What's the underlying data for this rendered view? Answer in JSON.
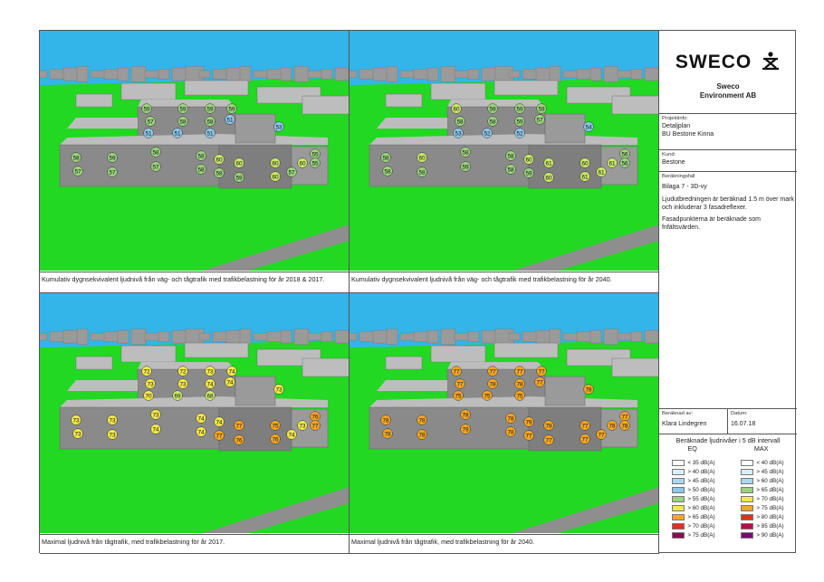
{
  "panels": [
    {
      "caption": "Kumulativ dygnsekvivalent ljudnivå från väg- och tågtrafik med trafikbelastning för år 2018 & 2017.",
      "labels": [
        "59",
        "59",
        "59",
        "59",
        "57",
        "58",
        "58",
        "51",
        "51",
        "51",
        "51",
        "53",
        "58",
        "59",
        "58",
        "58",
        "60",
        "60",
        "60",
        "60",
        "57",
        "57",
        "57",
        "58",
        "58",
        "59",
        "60",
        "57",
        "55",
        "55"
      ]
    },
    {
      "caption": "Kumulativ dygnsekvivalent ljudnivå från väg- och tågtrafik med trafikbelastning för år 2040.",
      "labels": [
        "60",
        "59",
        "59",
        "59",
        "58",
        "58",
        "59",
        "57",
        "53",
        "52",
        "52",
        "54",
        "58",
        "60",
        "58",
        "58",
        "60",
        "61",
        "60",
        "61",
        "58",
        "58",
        "59",
        "58",
        "59",
        "60",
        "61",
        "61",
        "56",
        "56"
      ]
    },
    {
      "caption": "Maximal ljudnivå från tågtrafik, med trafikbelastning för år 2017.",
      "labels": [
        "72",
        "72",
        "73",
        "74",
        "73",
        "73",
        "74",
        "74",
        "70",
        "69",
        "68",
        "73",
        "73",
        "73",
        "73",
        "74",
        "74",
        "77",
        "75",
        "73",
        "73",
        "73",
        "74",
        "74",
        "77",
        "76",
        "76",
        "74",
        "76",
        "77"
      ]
    },
    {
      "caption": "Maximal ljudnivå från tågtrafik, med trafikbelastning för år 2040.",
      "labels": [
        "77",
        "77",
        "77",
        "77",
        "77",
        "78",
        "78",
        "77",
        "75",
        "75",
        "75",
        "78",
        "78",
        "78",
        "78",
        "78",
        "79",
        "78",
        "77",
        "78",
        "78",
        "78",
        "79",
        "78",
        "77",
        "77",
        "77",
        "77",
        "77",
        "78"
      ]
    }
  ],
  "titleblock": {
    "logo": "SWECO",
    "company_line1": "Sweco",
    "company_line2": "Environment AB",
    "project_label": "Projektinfo:",
    "project_line1": "Detaljplan",
    "project_line2": "BU Bestone Kinna",
    "client_label": "Kund:",
    "client": "Bestone",
    "case_label": "Beräkningsfall",
    "case": "Bilaga 7 - 3D-vy",
    "note1": "Ljudutbredningen är beräknad 1.5 m över mark och inkluderar 3 fasadreflexer.",
    "note2": "Fasadpunkterna är beräknade som frifältsvärden.",
    "calc_by_label": "Beräknad av:",
    "calc_by": "Klara Lindegren",
    "date_label": "Datum:",
    "date": "16.07.18"
  },
  "legend": {
    "title": "Beräknade ljudnivåer i 5 dB intervall",
    "col_eq": "EQ",
    "col_max": "MAX",
    "eq": [
      {
        "label": "<  35 dB(A)",
        "color": "#ffffff"
      },
      {
        "label": ">  40 dB(A)",
        "color": "#d9eef7"
      },
      {
        "label": ">  45 dB(A)",
        "color": "#a9d8f0"
      },
      {
        "label": ">  50 dB(A)",
        "color": "#8cc7e8"
      },
      {
        "label": ">  55 dB(A)",
        "color": "#9bd27e"
      },
      {
        "label": ">  60 dB(A)",
        "color": "#f2e84a"
      },
      {
        "label": ">  65 dB(A)",
        "color": "#f5a623"
      },
      {
        "label": ">  70 dB(A)",
        "color": "#e0301e"
      },
      {
        "label": ">  75 dB(A)",
        "color": "#8b0a50"
      }
    ],
    "max": [
      {
        "label": "<  40 dB(A)",
        "color": "#ffffff"
      },
      {
        "label": ">  45 dB(A)",
        "color": "#d9eef7"
      },
      {
        "label": ">  60 dB(A)",
        "color": "#a9d8f0"
      },
      {
        "label": ">  65 dB(A)",
        "color": "#9bd27e"
      },
      {
        "label": ">  70 dB(A)",
        "color": "#f2e84a"
      },
      {
        "label": ">  75 dB(A)",
        "color": "#f5a623"
      },
      {
        "label": ">  80 dB(A)",
        "color": "#e0301e"
      },
      {
        "label": ">  85 dB(A)",
        "color": "#b0124a"
      },
      {
        "label": ">  90 dB(A)",
        "color": "#7a0a6e"
      }
    ]
  },
  "colors": {
    "sky": "#33b5ea",
    "grass": "#22d822",
    "road": "#8e8e8e",
    "building": "#8a8a8a",
    "building_roof": "#bdbdbd"
  }
}
